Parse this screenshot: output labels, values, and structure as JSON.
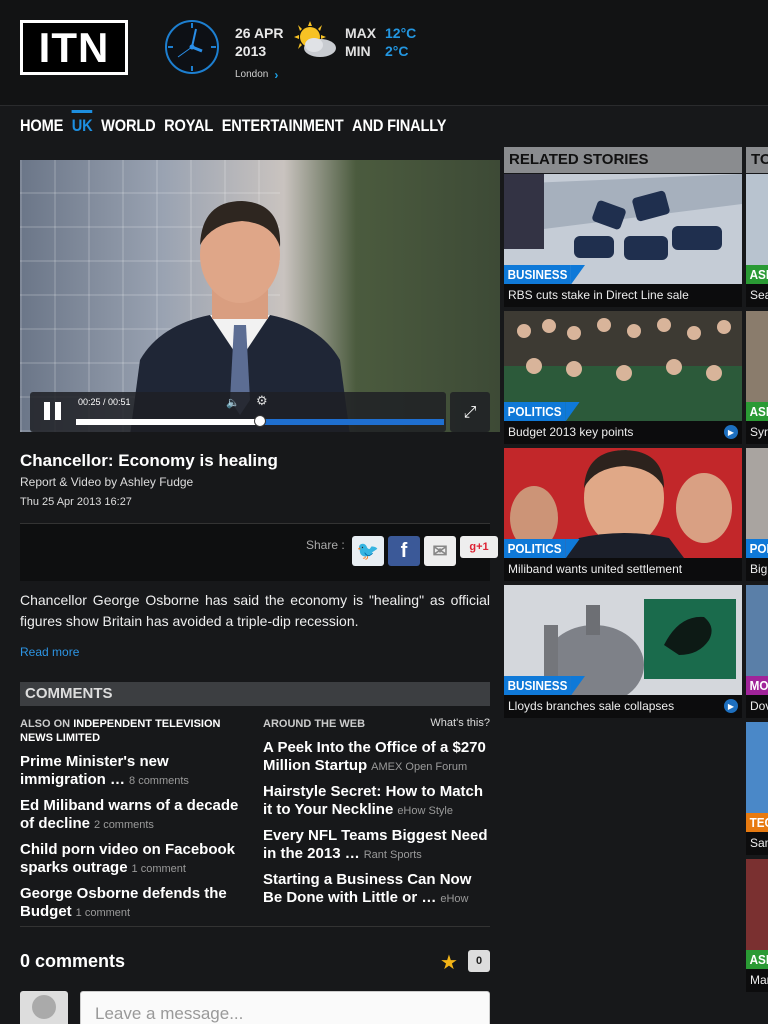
{
  "header": {
    "logo_text": "ITN",
    "date": {
      "day_month": "26 APR",
      "year": "2013",
      "city": "London"
    },
    "weather": {
      "max_label": "MAX",
      "min_label": "MIN",
      "max_temp": "12°C",
      "min_temp": "2°C"
    }
  },
  "nav": {
    "items": [
      "HOME",
      "UK",
      "WORLD",
      "ROYAL",
      "ENTERTAINMENT",
      "AND FINALLY"
    ],
    "active": "UK"
  },
  "video": {
    "time": "00:25 / 00:51",
    "progress_fraction": 0.5
  },
  "story": {
    "title": "Chancellor: Economy is healing",
    "byline": "Report & Video by Ashley Fudge",
    "date": "Thu 25 Apr 2013 16:27",
    "share_label": "Share :",
    "gplus_label": "+1",
    "summary": "Chancellor George Osborne has said the economy is \"healing\" as official figures show Britain has avoided a triple-dip recession.",
    "read_more": "Read more"
  },
  "comments": {
    "heading": "COMMENTS",
    "also_on_prefix": "ALSO ON",
    "also_on_source": "INDEPENDENT TELEVISION NEWS LIMITED",
    "around_web": "AROUND THE WEB",
    "whats_this": "What's this?",
    "left_links": [
      {
        "title": "Prime Minister's new immigration …",
        "meta": "8 comments"
      },
      {
        "title": "Ed Miliband warns of a decade of decline",
        "meta": "2 comments"
      },
      {
        "title": "Child porn video on Facebook sparks outrage",
        "meta": "1 comment"
      },
      {
        "title": "George Osborne defends the Budget",
        "meta": "1 comment"
      }
    ],
    "right_links": [
      {
        "title": "A Peek Into the Office of a $270 Million Startup",
        "meta": "AMEX Open Forum"
      },
      {
        "title": "Hairstyle Secret: How to Match it to Your Neckline",
        "meta": "eHow Style"
      },
      {
        "title": "Every NFL Teams Biggest Need in the 2013 …",
        "meta": "Rant Sports"
      },
      {
        "title": "Starting a Business Can Now Be Done with Little or …",
        "meta": "eHow"
      }
    ],
    "count_label": "0 comments",
    "star_count": "0",
    "placeholder": "Leave a message..."
  },
  "related": {
    "heading": "RELATED STORIES",
    "stories": [
      {
        "category": "BUSINESS",
        "caption": "RBS cuts stake in Direct Line sale"
      },
      {
        "category": "POLITICS",
        "caption": "Budget 2013 key points"
      },
      {
        "category": "POLITICS",
        "caption": "Miliband wants united settlement"
      },
      {
        "category": "BUSINESS",
        "caption": "Lloyds branches sale collapses"
      }
    ]
  },
  "top": {
    "heading": "TOP",
    "stories": [
      {
        "category": "ASIA",
        "caption": "Sea"
      },
      {
        "category": "ASIA",
        "caption": "Syri"
      },
      {
        "category": "POL",
        "caption": "Big"
      },
      {
        "category": "MOV",
        "caption": "Dov"
      },
      {
        "category": "TECH",
        "caption": "Sam"
      },
      {
        "category": "ASIA",
        "caption": "Mar"
      }
    ]
  },
  "colors": {
    "accent": "#1d8fe0",
    "business": "#0f79d8",
    "asia": "#2a9a34"
  }
}
